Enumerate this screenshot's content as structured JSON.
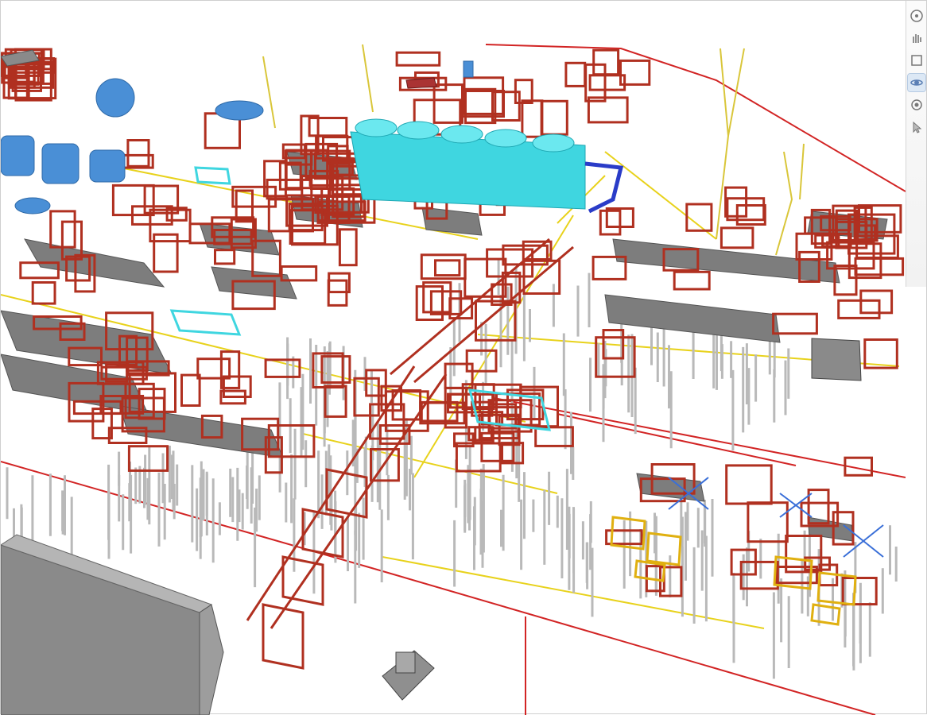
{
  "viewer": {
    "colors": {
      "steel": "#b03020",
      "steel_dark": "#8c2418",
      "deck": "#7d7d7d",
      "pipe": "#e8d21c",
      "piles": "#b9b9b9",
      "equipment_cyan": "#3fd6e0",
      "vessels_blue": "#4a8fd6",
      "boundary_line": "#d22424",
      "building": "#8a8a8a"
    },
    "nav_toolbar": [
      {
        "name": "steering-wheel-icon",
        "state": "normal"
      },
      {
        "name": "pan-hand-icon",
        "state": "normal"
      },
      {
        "name": "zoom-window-icon",
        "state": "normal"
      },
      {
        "name": "orbit-icon",
        "state": "active"
      },
      {
        "name": "look-around-icon",
        "state": "normal"
      },
      {
        "name": "select-arrow-icon",
        "state": "normal"
      }
    ]
  }
}
